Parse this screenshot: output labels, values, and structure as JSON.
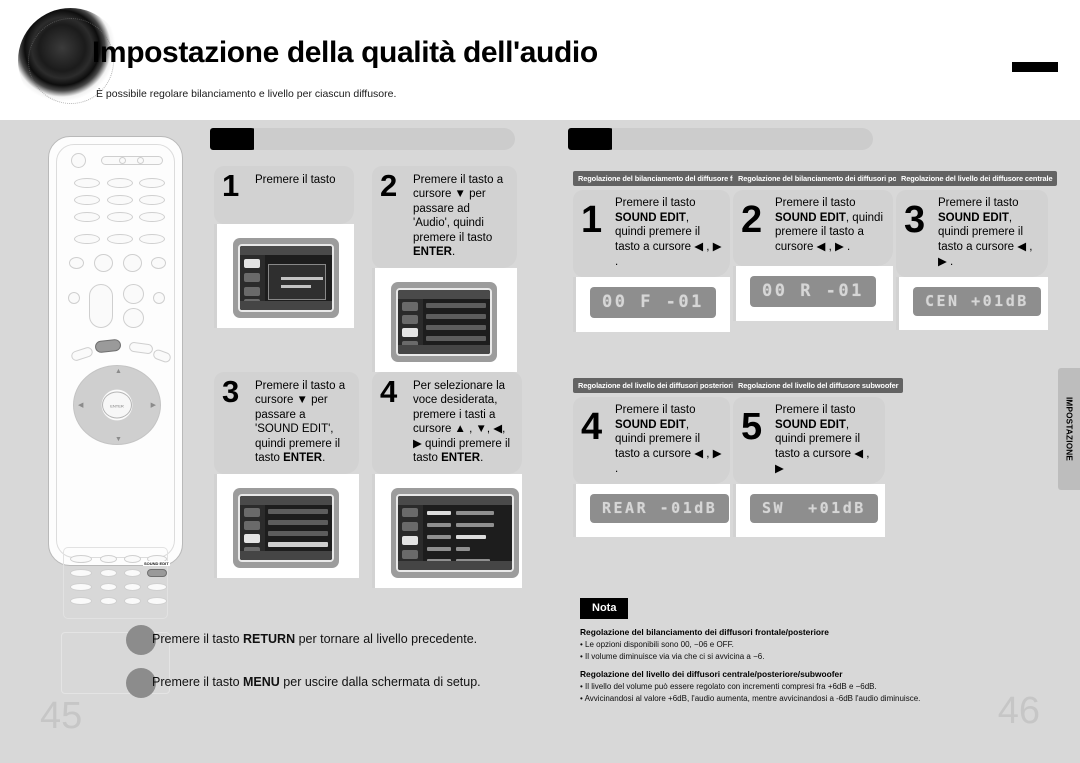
{
  "header": {
    "title": "Impostazione della qualità dell'audio",
    "subtitle": "È possibile regolare bilanciamento e livello per ciascun diffusore."
  },
  "remote": {
    "highlight_key": "SOUND EDIT",
    "enter_label": "ENTER"
  },
  "left_column": {
    "steps": [
      {
        "number": "1",
        "text_parts": [
          {
            "t": "Premere il tasto",
            "b": false
          }
        ]
      },
      {
        "number": "2",
        "text_parts": [
          {
            "t": "Premere il tasto a cursore ▼ per passare ad 'Audio', quindi premere il tasto ",
            "b": false
          },
          {
            "t": "ENTER",
            "b": true
          },
          {
            "t": ".",
            "b": false
          }
        ]
      },
      {
        "number": "3",
        "text_parts": [
          {
            "t": "Premere il tasto a cursore ▼ per passare a 'SOUND EDIT', quindi premere il tasto ",
            "b": false
          },
          {
            "t": "ENTER",
            "b": true
          },
          {
            "t": ".",
            "b": false
          }
        ]
      },
      {
        "number": "4",
        "text_parts": [
          {
            "t": "Per selezionare la voce desiderata, premere i tasti a cursore ▲ , ▼, ◀, ▶ quindi premere il tasto ",
            "b": false
          },
          {
            "t": "ENTER",
            "b": true
          },
          {
            "t": ".",
            "b": false
          }
        ]
      }
    ]
  },
  "right_column": {
    "panels": [
      {
        "label": "Regolazione del bilanciamento del diffusore frontale",
        "number": "1",
        "text_parts": [
          {
            "t": "Premere il tasto ",
            "b": false
          },
          {
            "t": "SOUND EDIT",
            "b": true
          },
          {
            "t": ", quindi premere il tasto a cursore ◀ , ▶ .",
            "b": false
          }
        ],
        "lcd": "00 F -01"
      },
      {
        "label": "Regolazione del bilanciamento dei diffusori posteriori",
        "number": "2",
        "text_parts": [
          {
            "t": "Premere il tasto ",
            "b": false
          },
          {
            "t": "SOUND EDIT",
            "b": true
          },
          {
            "t": ", quindi premere il tasto a cursore ◀ , ▶ .",
            "b": false
          }
        ],
        "lcd": "00 R -01"
      },
      {
        "label": "Regolazione del livello dei diffusore centrale",
        "number": "3",
        "text_parts": [
          {
            "t": "Premere il tasto ",
            "b": false
          },
          {
            "t": "SOUND EDIT",
            "b": true
          },
          {
            "t": ", quindi premere il tasto a cursore ◀ , ▶ .",
            "b": false
          }
        ],
        "lcd": "CEN +01dB"
      },
      {
        "label": "Regolazione del livello dei diffusori posteriori",
        "number": "4",
        "text_parts": [
          {
            "t": "Premere il tasto ",
            "b": false
          },
          {
            "t": "SOUND EDIT",
            "b": true
          },
          {
            "t": ", quindi premere il tasto a cursore ◀ , ▶ .",
            "b": false
          }
        ],
        "lcd": "REAR -01dB"
      },
      {
        "label": "Regolazione del livello del diffusore subwoofer",
        "number": "5",
        "text_parts": [
          {
            "t": "Premere il tasto ",
            "b": false
          },
          {
            "t": "SOUND EDIT",
            "b": true
          },
          {
            "t": ", quindi premere il tasto a cursore ◀ , ▶",
            "b": false
          }
        ],
        "lcd": "SW  +01dB"
      }
    ]
  },
  "footnotes": [
    {
      "parts": [
        {
          "t": "Premere il tasto ",
          "b": false
        },
        {
          "t": "RETURN",
          "b": true
        },
        {
          "t": " per tornare al livello precedente.",
          "b": false
        }
      ]
    },
    {
      "parts": [
        {
          "t": "Premere il tasto ",
          "b": false
        },
        {
          "t": "MENU",
          "b": true
        },
        {
          "t": " per uscire dalla schermata di setup.",
          "b": false
        }
      ]
    }
  ],
  "nota": {
    "badge": "Nota",
    "sections": [
      {
        "heading": "Regolazione del bilanciamento dei diffusori frontale/posteriore",
        "items": [
          "Le opzioni disponibili sono 00, −06 e OFF.",
          "Il volume diminuisce via via che ci si avvicina a −6."
        ]
      },
      {
        "heading": "Regolazione del livello dei diffusori centrale/posteriore/subwoofer",
        "items": [
          "Il livello del volume può essere regolato con incrementi compresi fra +6dB e −6dB.",
          "Avvicinandosi al valore +6dB, l'audio aumenta, mentre avvicinandosi a -6dB l'audio diminuisce."
        ]
      }
    ]
  },
  "side_tab": {
    "label": "IMPOSTAZIONE"
  },
  "page_numbers": {
    "left": "45",
    "right": "46"
  }
}
